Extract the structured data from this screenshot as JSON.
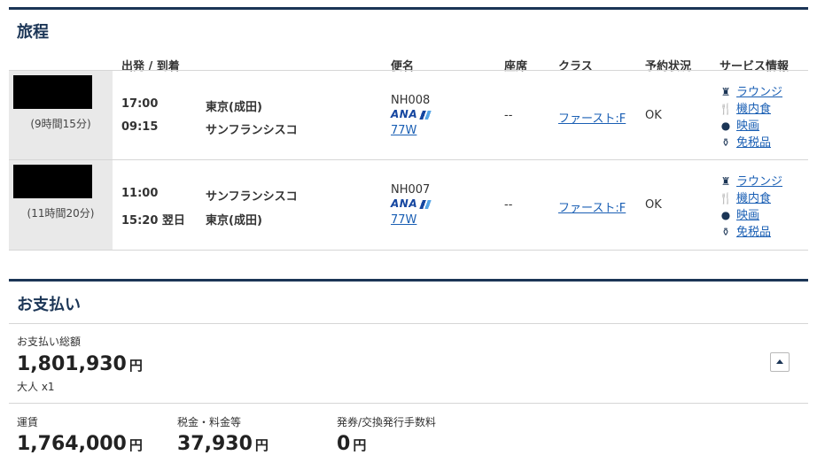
{
  "itinerary": {
    "title": "旅程",
    "headers": {
      "depart_arrive": "出発 / 到着",
      "flight": "便名",
      "seat": "座席",
      "class": "クラス",
      "status": "予約状況",
      "services": "サービス情報"
    },
    "flights": [
      {
        "duration": "(9時間15分)",
        "dep_time": "17:00",
        "dep_city": "東京(成田)",
        "arr_time": "09:15",
        "arr_city": "サンフランシスコ",
        "flight_no": "NH008",
        "carrier_logo": "ANA",
        "aircraft": "77W",
        "seat": "--",
        "class": "ファースト:F",
        "status": "OK",
        "services": [
          {
            "icon": "lounge-icon",
            "label": "ラウンジ"
          },
          {
            "icon": "meal-icon",
            "label": "機内食"
          },
          {
            "icon": "movie-icon",
            "label": "映画"
          },
          {
            "icon": "duty-free-icon",
            "label": "免税品"
          }
        ]
      },
      {
        "duration": "(11時間20分)",
        "dep_time": "11:00",
        "dep_city": "サンフランシスコ",
        "arr_time": "15:20 翌日",
        "arr_city": "東京(成田)",
        "flight_no": "NH007",
        "carrier_logo": "ANA",
        "aircraft": "77W",
        "seat": "--",
        "class": "ファースト:F",
        "status": "OK",
        "services": [
          {
            "icon": "lounge-icon",
            "label": "ラウンジ"
          },
          {
            "icon": "meal-icon",
            "label": "機内食"
          },
          {
            "icon": "movie-icon",
            "label": "映画"
          },
          {
            "icon": "duty-free-icon",
            "label": "免税品"
          }
        ]
      }
    ]
  },
  "payment": {
    "title": "お支払い",
    "total_label": "お支払い総額",
    "total_amount": "1,801,930",
    "currency": "円",
    "passengers": "大人 x1",
    "fare_label": "運賃",
    "fare_amount": "1,764,000",
    "tax_label": "税金・料金等",
    "tax_amount": "37,930",
    "fee_label": "発券/交換発行手数料",
    "fee_amount": "0"
  },
  "colors": {
    "navy": "#1b3556",
    "link": "#1a5fb4",
    "ana_blue": "#1546a0"
  }
}
